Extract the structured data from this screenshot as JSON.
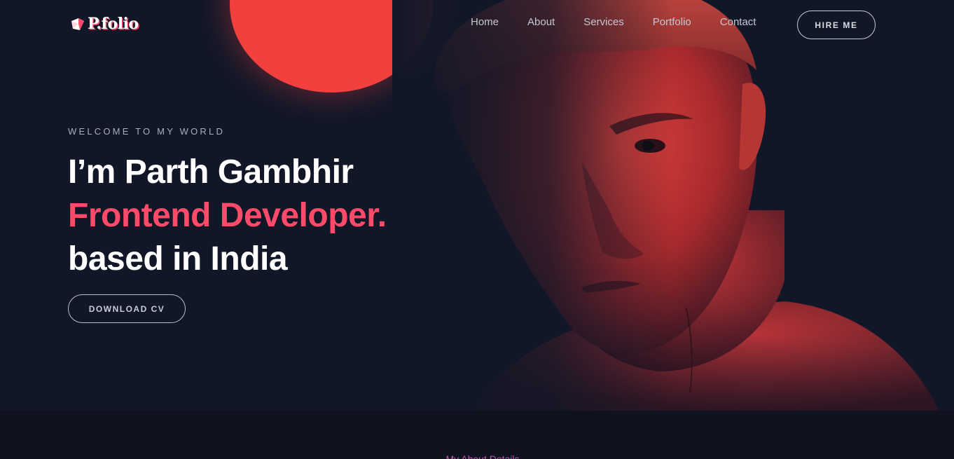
{
  "brand": {
    "logo_text": "P.folio",
    "accent_color": "#ff4a6a",
    "background_color": "#121728"
  },
  "nav": {
    "items": [
      {
        "label": "Home"
      },
      {
        "label": "About"
      },
      {
        "label": "Services"
      },
      {
        "label": "Portfolio"
      },
      {
        "label": "Contact"
      }
    ],
    "hire_label": "HIRE ME"
  },
  "hero": {
    "welcome": "WELCOME TO MY WORLD",
    "line1": "I’m Parth Gambhir",
    "line2": "Frontend Developer.",
    "line3": "based in India",
    "cv_label": "DOWNLOAD CV",
    "image_icon": "portrait-photo"
  },
  "about": {
    "title": "My About Details"
  }
}
